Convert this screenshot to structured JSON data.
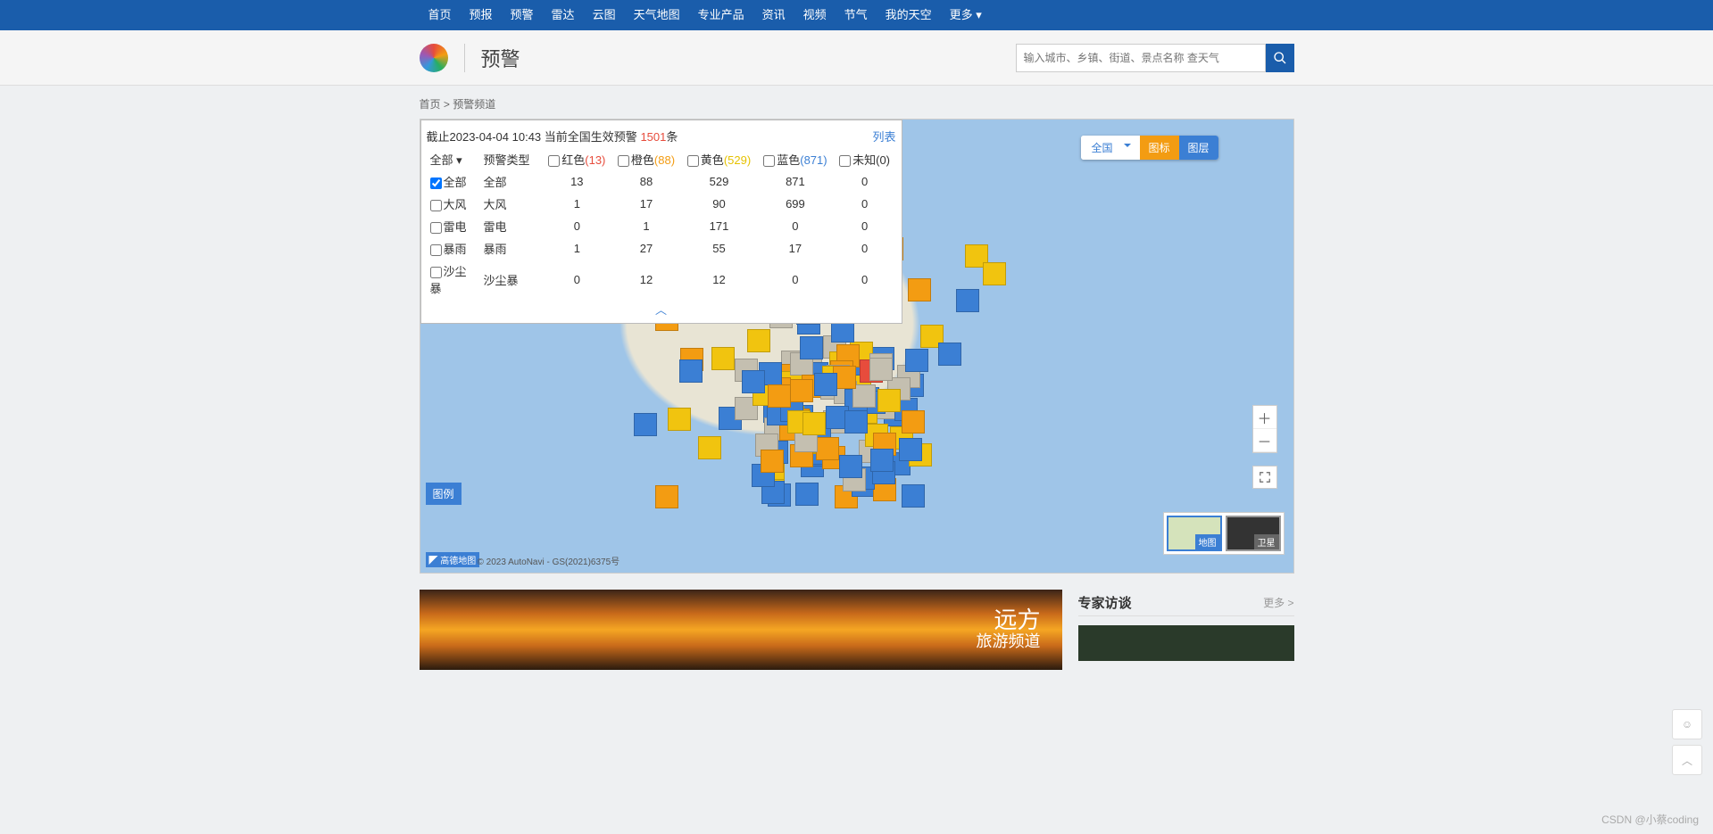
{
  "nav": [
    "首页",
    "预报",
    "预警",
    "雷达",
    "云图",
    "天气地图",
    "专业产品",
    "资讯",
    "视频",
    "节气",
    "我的天空",
    "更多"
  ],
  "header": {
    "title": "预警"
  },
  "search": {
    "placeholder": "输入城市、乡镇、街道、景点名称 查天气"
  },
  "crumb": {
    "home": "首页",
    "sep": ">",
    "current": "预警频道"
  },
  "panel": {
    "cutoff_prefix": "截止",
    "cutoff_time": "2023-04-04 10:43",
    "cutoff_mid": "当前全国生效预警",
    "count": "1501",
    "count_suffix": "条",
    "list_btn": "列表",
    "headers": {
      "all": "全部",
      "type": "预警类型",
      "red": "红色",
      "red_n": "(13)",
      "orange": "橙色",
      "orange_n": "(88)",
      "yellow": "黄色",
      "yellow_n": "(529)",
      "blue": "蓝色",
      "blue_n": "(871)",
      "unknown": "未知(0)"
    },
    "filters": [
      "全部",
      "大风",
      "雷电",
      "暴雨",
      "沙尘暴"
    ],
    "rows": [
      {
        "name": "全部",
        "r": "13",
        "o": "88",
        "y": "529",
        "b": "871",
        "u": "0"
      },
      {
        "name": "大风",
        "r": "1",
        "o": "17",
        "y": "90",
        "b": "699",
        "u": "0"
      },
      {
        "name": "雷电",
        "r": "0",
        "o": "1",
        "y": "171",
        "b": "0",
        "u": "0"
      },
      {
        "name": "暴雨",
        "r": "1",
        "o": "27",
        "y": "55",
        "b": "17",
        "u": "0"
      },
      {
        "name": "沙尘暴",
        "r": "0",
        "o": "12",
        "y": "12",
        "b": "0",
        "u": "0"
      }
    ]
  },
  "region_sel": "全国",
  "tab_icon": "图标",
  "tab_layer": "图层",
  "legend": "图例",
  "basemap": {
    "map": "地图",
    "sat": "卫星"
  },
  "amap": {
    "logo": "高德地图",
    "cr": "© 2023 AutoNavi - GS(2021)6375号"
  },
  "banner": {
    "line1": "远方",
    "line2": "旅游频道"
  },
  "side": {
    "title": "专家访谈",
    "more": "更多 >"
  },
  "watermark": "CSDN @小蔡coding",
  "chart_data": {
    "type": "table",
    "title": "全国生效预警统计",
    "columns": [
      "预警类型",
      "红色",
      "橙色",
      "黄色",
      "蓝色",
      "未知"
    ],
    "rows": [
      [
        "全部",
        13,
        88,
        529,
        871,
        0
      ],
      [
        "大风",
        1,
        17,
        90,
        699,
        0
      ],
      [
        "雷电",
        0,
        1,
        171,
        0,
        0
      ],
      [
        "暴雨",
        1,
        27,
        55,
        17,
        0
      ],
      [
        "沙尘暴",
        0,
        12,
        12,
        0,
        0
      ]
    ],
    "total": 1501
  }
}
